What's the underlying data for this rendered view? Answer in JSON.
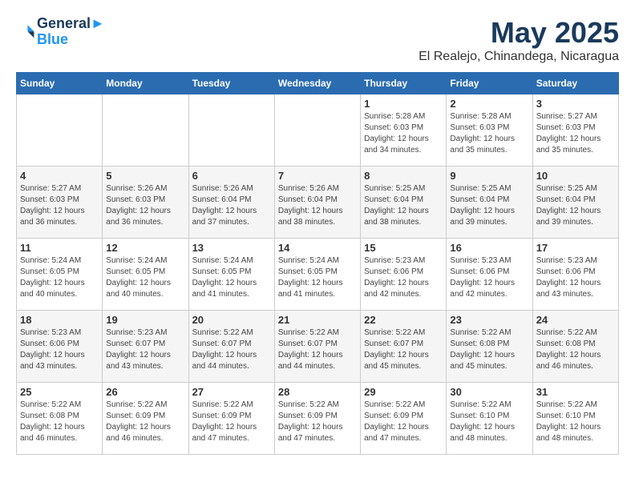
{
  "header": {
    "logo_line1": "General",
    "logo_line2": "Blue",
    "title": "May 2025",
    "subtitle": "El Realejo, Chinandega, Nicaragua"
  },
  "days_of_week": [
    "Sunday",
    "Monday",
    "Tuesday",
    "Wednesday",
    "Thursday",
    "Friday",
    "Saturday"
  ],
  "weeks": [
    [
      {
        "day": "",
        "info": ""
      },
      {
        "day": "",
        "info": ""
      },
      {
        "day": "",
        "info": ""
      },
      {
        "day": "",
        "info": ""
      },
      {
        "day": "1",
        "info": "Sunrise: 5:28 AM\nSunset: 6:03 PM\nDaylight: 12 hours\nand 34 minutes."
      },
      {
        "day": "2",
        "info": "Sunrise: 5:28 AM\nSunset: 6:03 PM\nDaylight: 12 hours\nand 35 minutes."
      },
      {
        "day": "3",
        "info": "Sunrise: 5:27 AM\nSunset: 6:03 PM\nDaylight: 12 hours\nand 35 minutes."
      }
    ],
    [
      {
        "day": "4",
        "info": "Sunrise: 5:27 AM\nSunset: 6:03 PM\nDaylight: 12 hours\nand 36 minutes."
      },
      {
        "day": "5",
        "info": "Sunrise: 5:26 AM\nSunset: 6:03 PM\nDaylight: 12 hours\nand 36 minutes."
      },
      {
        "day": "6",
        "info": "Sunrise: 5:26 AM\nSunset: 6:04 PM\nDaylight: 12 hours\nand 37 minutes."
      },
      {
        "day": "7",
        "info": "Sunrise: 5:26 AM\nSunset: 6:04 PM\nDaylight: 12 hours\nand 38 minutes."
      },
      {
        "day": "8",
        "info": "Sunrise: 5:25 AM\nSunset: 6:04 PM\nDaylight: 12 hours\nand 38 minutes."
      },
      {
        "day": "9",
        "info": "Sunrise: 5:25 AM\nSunset: 6:04 PM\nDaylight: 12 hours\nand 39 minutes."
      },
      {
        "day": "10",
        "info": "Sunrise: 5:25 AM\nSunset: 6:04 PM\nDaylight: 12 hours\nand 39 minutes."
      }
    ],
    [
      {
        "day": "11",
        "info": "Sunrise: 5:24 AM\nSunset: 6:05 PM\nDaylight: 12 hours\nand 40 minutes."
      },
      {
        "day": "12",
        "info": "Sunrise: 5:24 AM\nSunset: 6:05 PM\nDaylight: 12 hours\nand 40 minutes."
      },
      {
        "day": "13",
        "info": "Sunrise: 5:24 AM\nSunset: 6:05 PM\nDaylight: 12 hours\nand 41 minutes."
      },
      {
        "day": "14",
        "info": "Sunrise: 5:24 AM\nSunset: 6:05 PM\nDaylight: 12 hours\nand 41 minutes."
      },
      {
        "day": "15",
        "info": "Sunrise: 5:23 AM\nSunset: 6:06 PM\nDaylight: 12 hours\nand 42 minutes."
      },
      {
        "day": "16",
        "info": "Sunrise: 5:23 AM\nSunset: 6:06 PM\nDaylight: 12 hours\nand 42 minutes."
      },
      {
        "day": "17",
        "info": "Sunrise: 5:23 AM\nSunset: 6:06 PM\nDaylight: 12 hours\nand 43 minutes."
      }
    ],
    [
      {
        "day": "18",
        "info": "Sunrise: 5:23 AM\nSunset: 6:06 PM\nDaylight: 12 hours\nand 43 minutes."
      },
      {
        "day": "19",
        "info": "Sunrise: 5:23 AM\nSunset: 6:07 PM\nDaylight: 12 hours\nand 43 minutes."
      },
      {
        "day": "20",
        "info": "Sunrise: 5:22 AM\nSunset: 6:07 PM\nDaylight: 12 hours\nand 44 minutes."
      },
      {
        "day": "21",
        "info": "Sunrise: 5:22 AM\nSunset: 6:07 PM\nDaylight: 12 hours\nand 44 minutes."
      },
      {
        "day": "22",
        "info": "Sunrise: 5:22 AM\nSunset: 6:07 PM\nDaylight: 12 hours\nand 45 minutes."
      },
      {
        "day": "23",
        "info": "Sunrise: 5:22 AM\nSunset: 6:08 PM\nDaylight: 12 hours\nand 45 minutes."
      },
      {
        "day": "24",
        "info": "Sunrise: 5:22 AM\nSunset: 6:08 PM\nDaylight: 12 hours\nand 46 minutes."
      }
    ],
    [
      {
        "day": "25",
        "info": "Sunrise: 5:22 AM\nSunset: 6:08 PM\nDaylight: 12 hours\nand 46 minutes."
      },
      {
        "day": "26",
        "info": "Sunrise: 5:22 AM\nSunset: 6:09 PM\nDaylight: 12 hours\nand 46 minutes."
      },
      {
        "day": "27",
        "info": "Sunrise: 5:22 AM\nSunset: 6:09 PM\nDaylight: 12 hours\nand 47 minutes."
      },
      {
        "day": "28",
        "info": "Sunrise: 5:22 AM\nSunset: 6:09 PM\nDaylight: 12 hours\nand 47 minutes."
      },
      {
        "day": "29",
        "info": "Sunrise: 5:22 AM\nSunset: 6:09 PM\nDaylight: 12 hours\nand 47 minutes."
      },
      {
        "day": "30",
        "info": "Sunrise: 5:22 AM\nSunset: 6:10 PM\nDaylight: 12 hours\nand 48 minutes."
      },
      {
        "day": "31",
        "info": "Sunrise: 5:22 AM\nSunset: 6:10 PM\nDaylight: 12 hours\nand 48 minutes."
      }
    ]
  ]
}
